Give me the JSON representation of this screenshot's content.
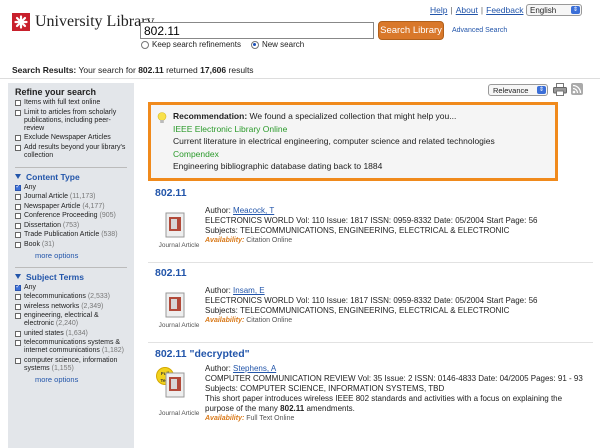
{
  "header": {
    "logo_text": "University Library",
    "search_value": "802.11",
    "search_button": "Search Library",
    "advanced_search": "Advanced Search",
    "radio_keep": "Keep search refinements",
    "radio_new": "New search",
    "links": {
      "help": "Help",
      "about": "About",
      "feedback": "Feedback"
    },
    "language": "English"
  },
  "results_summary": {
    "prefix": "Search Results:",
    "text1": "Your search for",
    "query": "802.11",
    "text2": "returned",
    "count": "17,606",
    "text3": "results"
  },
  "sidebar": {
    "title": "Refine your search",
    "refine_options": [
      {
        "label": "Items with full text online",
        "checked": false
      },
      {
        "label": "Limit to articles from scholarly publications, including peer-review",
        "checked": false
      },
      {
        "label": "Exclude Newspaper Articles",
        "checked": false
      },
      {
        "label": "Add results beyond your library's collection",
        "checked": false
      }
    ],
    "content_type": {
      "title": "Content Type",
      "items": [
        {
          "label": "Any",
          "count": "",
          "checked": true
        },
        {
          "label": "Journal Article",
          "count": "(11,173)",
          "checked": false
        },
        {
          "label": "Newspaper Article",
          "count": "(4,177)",
          "checked": false
        },
        {
          "label": "Conference Proceeding",
          "count": "(905)",
          "checked": false
        },
        {
          "label": "Dissertation",
          "count": "(753)",
          "checked": false
        },
        {
          "label": "Trade Publication Article",
          "count": "(538)",
          "checked": false
        },
        {
          "label": "Book",
          "count": "(31)",
          "checked": false
        }
      ],
      "more": "more options"
    },
    "subject_terms": {
      "title": "Subject Terms",
      "items": [
        {
          "label": "Any",
          "count": "",
          "checked": true
        },
        {
          "label": "telecommunications",
          "count": "(2,533)",
          "checked": false
        },
        {
          "label": "wireless networks",
          "count": "(2,349)",
          "checked": false
        },
        {
          "label": "engineering, electrical & electronic",
          "count": "(2,240)",
          "checked": false
        },
        {
          "label": "united states",
          "count": "(1,634)",
          "checked": false
        },
        {
          "label": "telecommunications systems & internet communications",
          "count": "(1,182)",
          "checked": false
        },
        {
          "label": "computer science, information systems",
          "count": "(1,155)",
          "checked": false
        }
      ],
      "more": "more options"
    }
  },
  "sort": {
    "value": "Relevance"
  },
  "recommendation": {
    "label": "Recommendation:",
    "text": "We found a specialized collection that might help you...",
    "items": [
      {
        "name": "IEEE Electronic Library Online",
        "desc": "Current literature in electrical engineering, computer science and related technologies"
      },
      {
        "name": "Compendex",
        "desc": "Engineering bibliographic database dating back to 1884"
      }
    ]
  },
  "results": [
    {
      "title": "802.11",
      "title_suffix": "",
      "type": "Journal Article",
      "author_label": "Author:",
      "author": "Meacock, T",
      "source": "ELECTRONICS WORLD Vol: 110 Issue: 1817 ISSN: 0959-8332 Date: 05/2004 Start Page: 56",
      "subjects": "Subjects: TELECOMMUNICATIONS, ENGINEERING, ELECTRICAL & ELECTRONIC",
      "availability_label": "Availability:",
      "availability": "Citation Online",
      "badge": ""
    },
    {
      "title": "802.11",
      "title_suffix": "",
      "type": "Journal Article",
      "author_label": "Author:",
      "author": "Insam, E",
      "source": "ELECTRONICS WORLD Vol: 110 Issue: 1817 ISSN: 0959-8332 Date: 05/2004 Start Page: 56",
      "subjects": "Subjects: TELECOMMUNICATIONS, ENGINEERING, ELECTRICAL & ELECTRONIC",
      "availability_label": "Availability:",
      "availability": "Citation Online",
      "badge": ""
    },
    {
      "title": "802.11",
      "title_suffix": "\"decrypted\"",
      "type": "Journal Article",
      "author_label": "Author:",
      "author": "Stephens, A",
      "source": "COMPUTER COMMUNICATION REVIEW Vol: 35 Issue: 2 ISSN: 0146-4833 Date: 04/2005 Pages: 91 - 93",
      "subjects": "Subjects: COMPUTER SCIENCE, INFORMATION SYSTEMS, TBD",
      "abstract_pre": "This short paper introduces wireless IEEE 802 standards and activities with a focus on explaining the purpose of the many",
      "abstract_hl": "802.11",
      "abstract_post": "amendments.",
      "availability_label": "Availability:",
      "availability": "Full Text Online",
      "badge": "Full Text"
    }
  ]
}
